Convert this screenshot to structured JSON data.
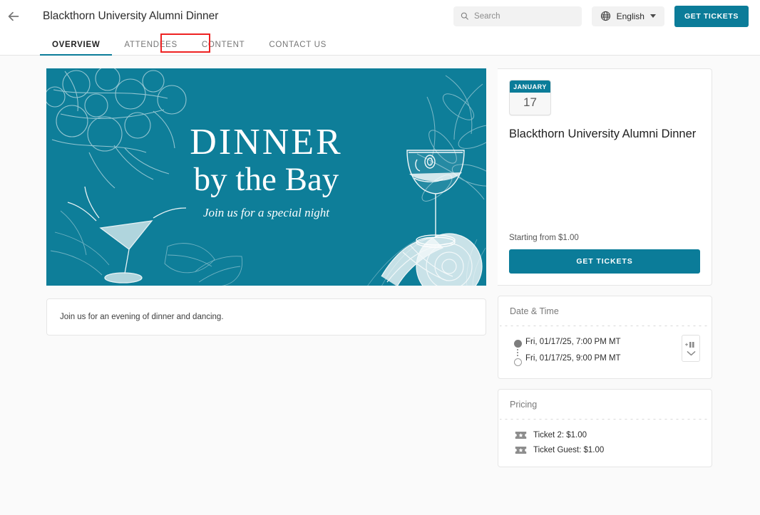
{
  "header": {
    "back_icon": "back-arrow-icon",
    "title": "Blackthorn University Alumni Dinner",
    "search": {
      "placeholder": "Search",
      "value": "",
      "icon": "search-icon"
    },
    "language": {
      "label": "English",
      "icon": "globe-icon",
      "caret": "chevron-down-icon"
    },
    "get_tickets_label": "GET TICKETS"
  },
  "tabs": [
    {
      "label": "OVERVIEW",
      "active": true
    },
    {
      "label": "ATTENDEES",
      "active": false
    },
    {
      "label": "CONTENT",
      "active": false,
      "annotated": true
    },
    {
      "label": "CONTACT US",
      "active": false
    }
  ],
  "annotation": {
    "color": "#ee2222",
    "target": "CONTENT"
  },
  "hero": {
    "line1": "DINNER",
    "line2": "by the Bay",
    "line3": "Join us for a special night",
    "background_color": "#0e7e99",
    "art_color": "#ffffff"
  },
  "event": {
    "date_month": "JANUARY",
    "date_day": "17",
    "title": "Blackthorn University Alumni Dinner",
    "starting_from": "Starting from $1.00",
    "get_tickets_label": "GET TICKETS"
  },
  "description": {
    "text": "Join us for an evening of dinner and dancing."
  },
  "date_time": {
    "header": "Date & Time",
    "start": "Fri, 01/17/25, 7:00 PM MT",
    "end": "Fri, 01/17/25, 9:00 PM MT",
    "add_to_calendar_icon": "add-to-calendar-icon"
  },
  "pricing": {
    "header": "Pricing",
    "items": [
      {
        "label": "Ticket 2: $1.00",
        "icon": "ticket-icon"
      },
      {
        "label": "Ticket Guest: $1.00",
        "icon": "ticket-icon"
      }
    ]
  },
  "theme": {
    "accent": "#0b7c99",
    "hero_teal": "#0e7e99",
    "page_bg": "#fafafa"
  }
}
